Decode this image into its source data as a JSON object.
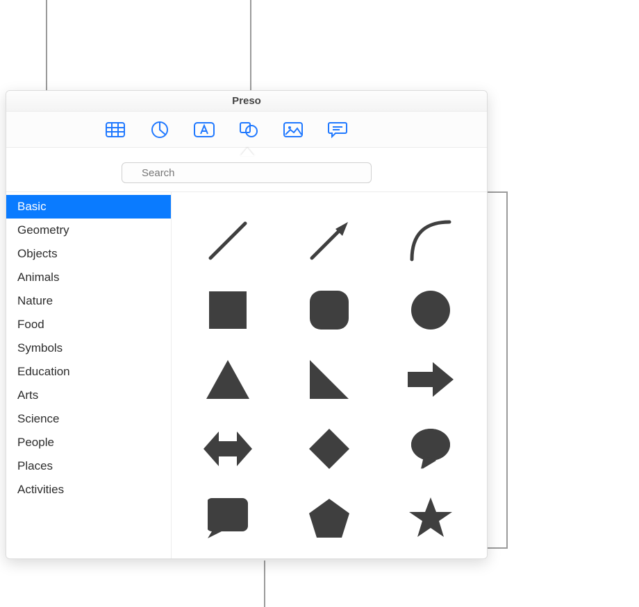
{
  "window": {
    "title": "Preso"
  },
  "toolbar": {
    "tools": [
      {
        "name": "table-tool"
      },
      {
        "name": "chart-tool"
      },
      {
        "name": "text-tool"
      },
      {
        "name": "shape-tool"
      },
      {
        "name": "media-tool"
      },
      {
        "name": "comment-tool"
      }
    ]
  },
  "search": {
    "placeholder": "Search"
  },
  "sidebar": {
    "selected": 0,
    "items": [
      {
        "label": "Basic"
      },
      {
        "label": "Geometry"
      },
      {
        "label": "Objects"
      },
      {
        "label": "Animals"
      },
      {
        "label": "Nature"
      },
      {
        "label": "Food"
      },
      {
        "label": "Symbols"
      },
      {
        "label": "Education"
      },
      {
        "label": "Arts"
      },
      {
        "label": "Science"
      },
      {
        "label": "People"
      },
      {
        "label": "Places"
      },
      {
        "label": "Activities"
      }
    ]
  },
  "shapes": {
    "items": [
      {
        "name": "line"
      },
      {
        "name": "arrow-line"
      },
      {
        "name": "curve"
      },
      {
        "name": "square"
      },
      {
        "name": "rounded-square"
      },
      {
        "name": "circle"
      },
      {
        "name": "triangle"
      },
      {
        "name": "right-triangle"
      },
      {
        "name": "arrow-right"
      },
      {
        "name": "arrow-left-right"
      },
      {
        "name": "diamond"
      },
      {
        "name": "speech-bubble"
      },
      {
        "name": "square-bubble"
      },
      {
        "name": "pentagon"
      },
      {
        "name": "star"
      }
    ]
  },
  "colors": {
    "accent": "#0a7bff",
    "shape": "#3f3f3f",
    "tool": "#1f78ff"
  }
}
